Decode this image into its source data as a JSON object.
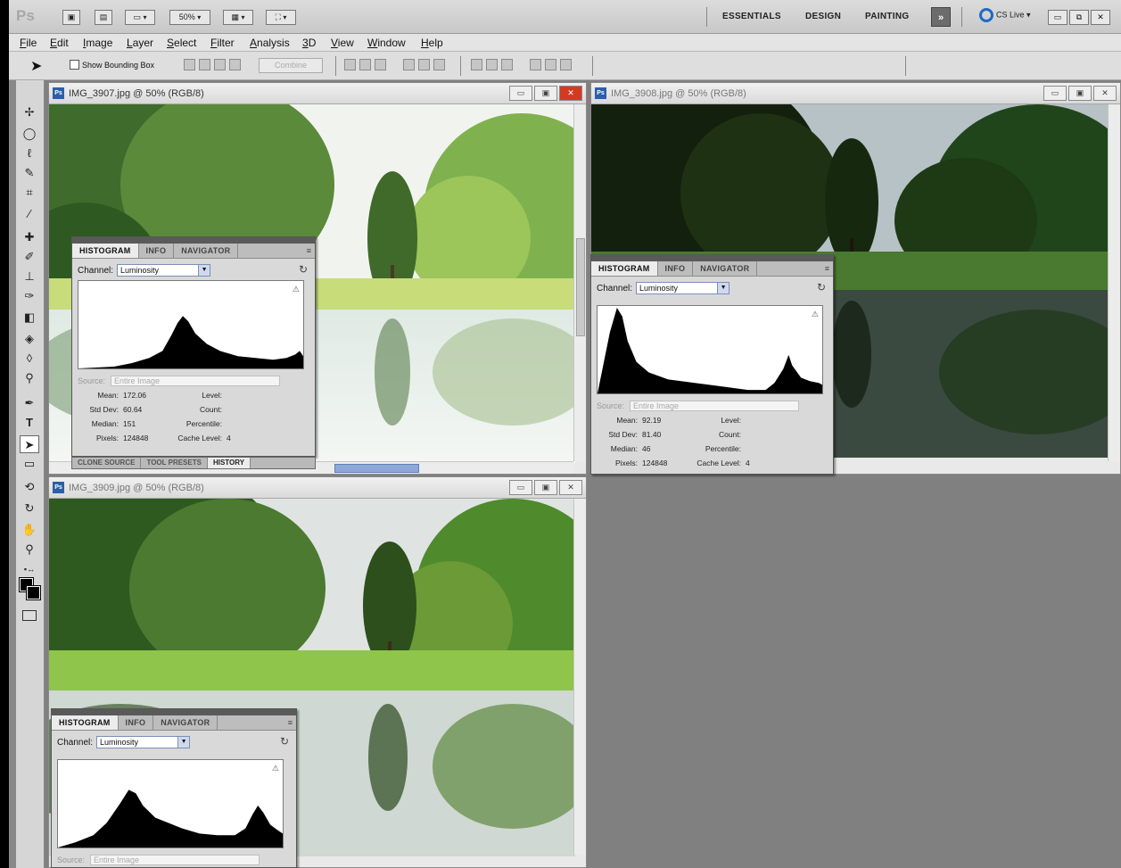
{
  "app": {
    "logo": "Ps",
    "zoom_display": "50%",
    "workspaces": [
      "ESSENTIALS",
      "DESIGN",
      "PAINTING"
    ],
    "more_label": "»",
    "cs_live": "CS Live"
  },
  "menus": [
    "File",
    "Edit",
    "Image",
    "Layer",
    "Select",
    "Filter",
    "Analysis",
    "3D",
    "View",
    "Window",
    "Help"
  ],
  "options": {
    "show_bounding_box": "Show Bounding Box",
    "combine": "Combine"
  },
  "documents": [
    {
      "title": "IMG_3907.jpg @ 50% (RGB/8)",
      "active": true,
      "scene": "bright"
    },
    {
      "title": "IMG_3908.jpg @ 50% (RGB/8)",
      "active": false,
      "scene": "dark"
    },
    {
      "title": "IMG_3909.jpg @ 50% (RGB/8)",
      "active": false,
      "scene": "normal"
    }
  ],
  "histograms": [
    {
      "tabs": [
        "HISTOGRAM",
        "INFO",
        "NAVIGATOR"
      ],
      "channel_label": "Channel:",
      "channel": "Luminosity",
      "source_label": "Source:",
      "source": "Entire Image",
      "stats": {
        "mean": {
          "label": "Mean:",
          "value": "172.06"
        },
        "std_dev": {
          "label": "Std Dev:",
          "value": "60.64"
        },
        "median": {
          "label": "Median:",
          "value": "151"
        },
        "pixels": {
          "label": "Pixels:",
          "value": "124848"
        },
        "level": {
          "label": "Level:",
          "value": ""
        },
        "count": {
          "label": "Count:",
          "value": ""
        },
        "percentile": {
          "label": "Percentile:",
          "value": ""
        },
        "cache_level": {
          "label": "Cache Level:",
          "value": "4"
        }
      }
    },
    {
      "tabs": [
        "HISTOGRAM",
        "INFO",
        "NAVIGATOR"
      ],
      "channel_label": "Channel:",
      "channel": "Luminosity",
      "source_label": "Source:",
      "source": "Entire Image",
      "stats": {
        "mean": {
          "label": "Mean:",
          "value": "92.19"
        },
        "std_dev": {
          "label": "Std Dev:",
          "value": "81.40"
        },
        "median": {
          "label": "Median:",
          "value": "46"
        },
        "pixels": {
          "label": "Pixels:",
          "value": "124848"
        },
        "level": {
          "label": "Level:",
          "value": ""
        },
        "count": {
          "label": "Count:",
          "value": ""
        },
        "percentile": {
          "label": "Percentile:",
          "value": ""
        },
        "cache_level": {
          "label": "Cache Level:",
          "value": "4"
        }
      }
    },
    {
      "tabs": [
        "HISTOGRAM",
        "INFO",
        "NAVIGATOR"
      ],
      "channel_label": "Channel:",
      "channel": "Luminosity",
      "source_label": "Source:",
      "source": "Entire Image"
    }
  ],
  "bottom_panel_tabs": [
    "CLONE SOURCE",
    "TOOL PRESETS",
    "HISTORY"
  ],
  "status_zoom": "50%",
  "colors": {
    "foreground": "#000000",
    "background": "#000000",
    "workspace": "#808080",
    "close_active": "#d43a22"
  }
}
